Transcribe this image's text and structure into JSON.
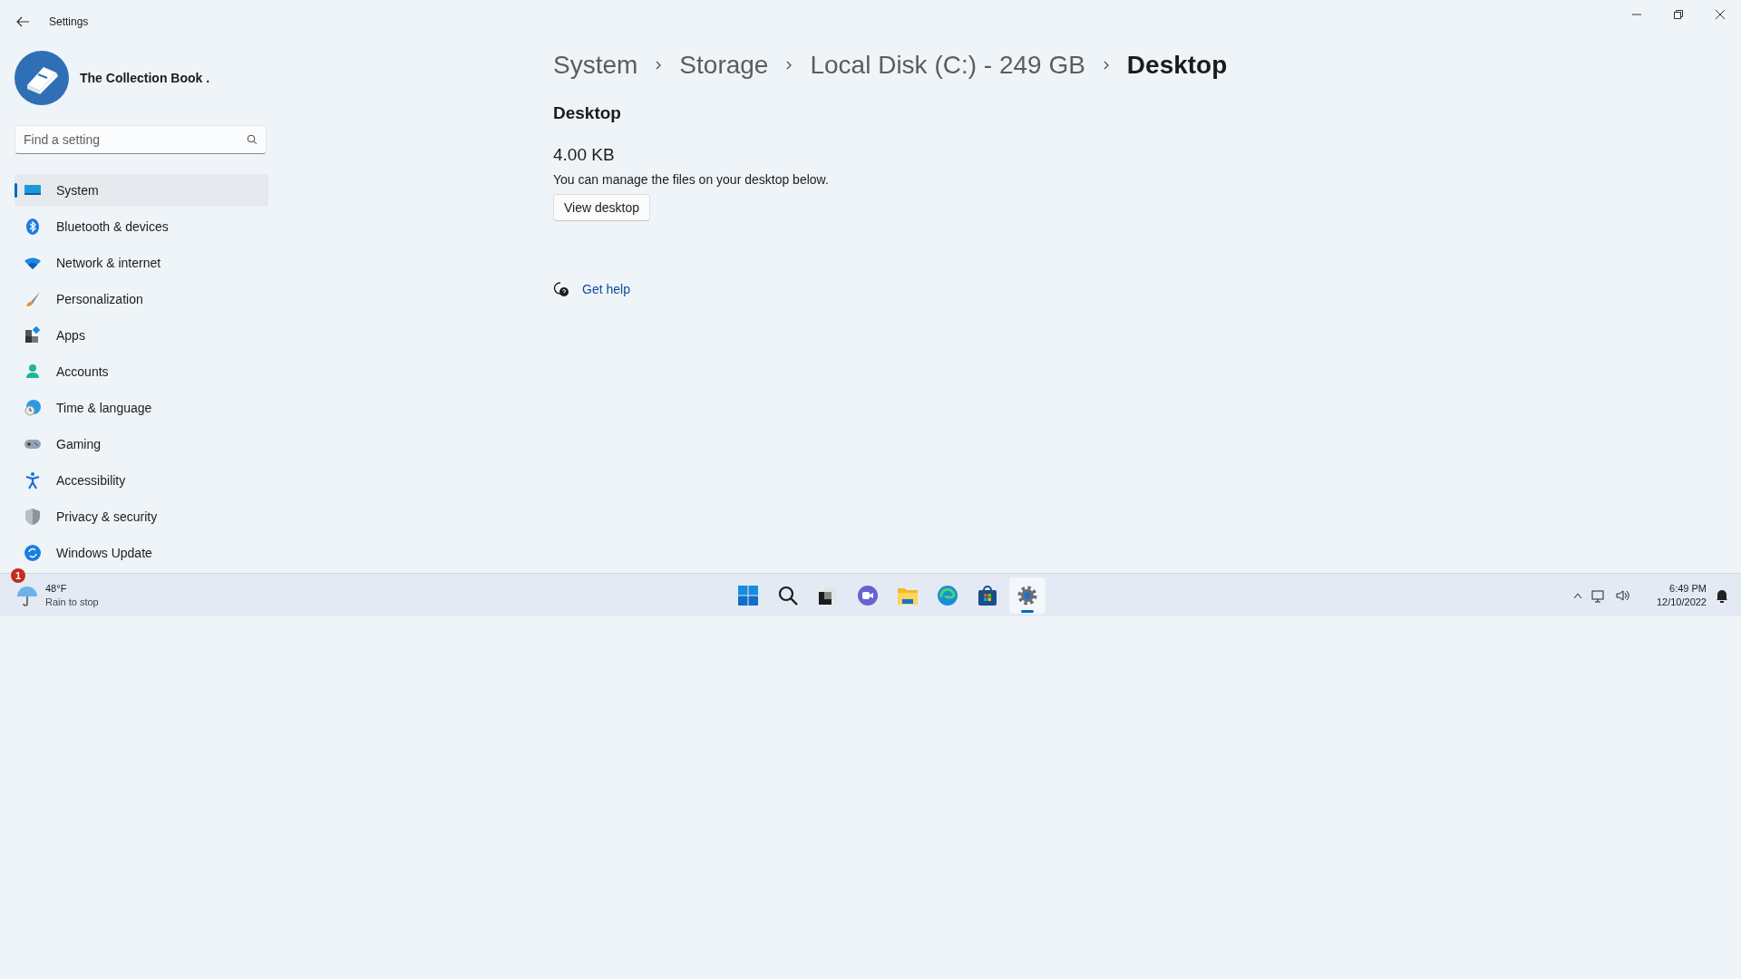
{
  "window": {
    "title": "Settings"
  },
  "account": {
    "name": "The Collection Book ."
  },
  "search": {
    "placeholder": "Find a setting"
  },
  "nav": [
    {
      "label": "System",
      "selected": true
    },
    {
      "label": "Bluetooth & devices",
      "selected": false
    },
    {
      "label": "Network & internet",
      "selected": false
    },
    {
      "label": "Personalization",
      "selected": false
    },
    {
      "label": "Apps",
      "selected": false
    },
    {
      "label": "Accounts",
      "selected": false
    },
    {
      "label": "Time & language",
      "selected": false
    },
    {
      "label": "Gaming",
      "selected": false
    },
    {
      "label": "Accessibility",
      "selected": false
    },
    {
      "label": "Privacy & security",
      "selected": false
    },
    {
      "label": "Windows Update",
      "selected": false
    }
  ],
  "breadcrumb": [
    "System",
    "Storage",
    "Local Disk (C:) - 249 GB",
    "Desktop"
  ],
  "section": {
    "title": "Desktop",
    "size": "4.00 KB",
    "description": "You can manage the files on your desktop below.",
    "button": "View desktop"
  },
  "help": {
    "label": "Get help"
  },
  "taskbar": {
    "weather": {
      "badge": "1",
      "temperature": "48°F",
      "condition": "Rain to stop"
    },
    "apps": [
      {
        "active": false
      },
      {
        "active": false
      },
      {
        "active": false
      },
      {
        "active": false
      },
      {
        "active": false
      },
      {
        "active": false
      },
      {
        "active": false
      },
      {
        "active": true
      }
    ],
    "time": "6:49 PM",
    "date": "12/10/2022"
  }
}
